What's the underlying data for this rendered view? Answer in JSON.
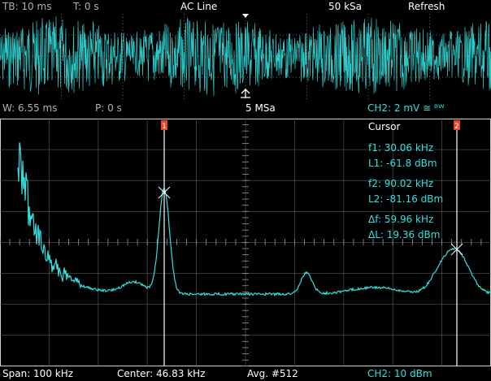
{
  "top_bar": {
    "timebase": "TB: 10 ms",
    "trigger_time": "T: 0 s",
    "trigger_source": "AC Line",
    "sample_rate": "50 kSa",
    "mode": "Refresh"
  },
  "mid_bar": {
    "window": "W: 6.55 ms",
    "position": "P: 0 s",
    "fft_sample_rate": "5 MSa",
    "channel_scale": "CH2: 2 mV ≅ ᴮᵂ"
  },
  "cursor_panel": {
    "title": "Cursor",
    "f1": "f1: 30.06 kHz",
    "l1": "L1: -61.8 dBm",
    "f2": "f2: 90.02 kHz",
    "l2": "L2: -81.16 dBm",
    "df": "Δf: 59.96 kHz",
    "dl": "ΔL: 19.36 dBm",
    "marker1": "1",
    "marker2": "2"
  },
  "bottom_bar": {
    "span": "Span: 100 kHz",
    "center": "Center: 46.83 kHz",
    "average": "Avg. #512",
    "channel_ref": "CH2: 10 dBm"
  },
  "colors": {
    "trace": "#33e0e0",
    "grid": "#666666",
    "marker": "#e04a2a"
  }
}
